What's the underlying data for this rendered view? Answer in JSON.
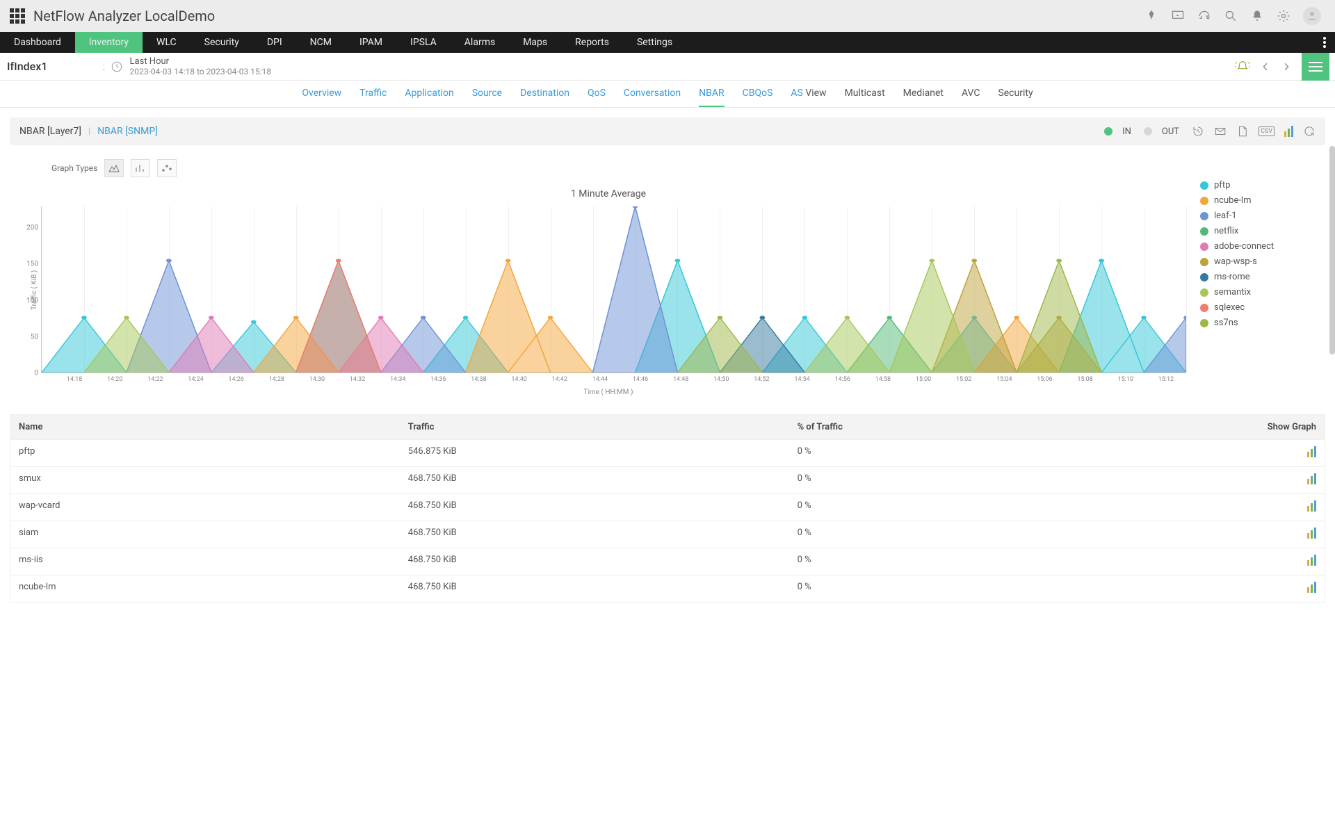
{
  "app_title": "NetFlow Analyzer LocalDemo",
  "nav": [
    "Dashboard",
    "Inventory",
    "WLC",
    "Security",
    "DPI",
    "NCM",
    "IPAM",
    "IPSLA",
    "Alarms",
    "Maps",
    "Reports",
    "Settings"
  ],
  "nav_active": 1,
  "subheader": {
    "interface": "IfIndex1",
    "stray": ";",
    "period_label": "Last Hour",
    "period_range": "2023-04-03 14:18 to 2023-04-03 15:18"
  },
  "tabs": [
    {
      "label": "Overview",
      "plain": false
    },
    {
      "label": "Traffic",
      "plain": false
    },
    {
      "label": "Application",
      "plain": false
    },
    {
      "label": "Source",
      "plain": false
    },
    {
      "label": "Destination",
      "plain": false
    },
    {
      "label": "QoS",
      "plain": false
    },
    {
      "label": "Conversation",
      "plain": false
    },
    {
      "label": "NBAR",
      "plain": false,
      "active": true
    },
    {
      "label": "CBQoS",
      "plain": false
    },
    {
      "label": "AS View",
      "plain": true,
      "as_prefix": "AS "
    },
    {
      "label": "Multicast",
      "plain": true
    },
    {
      "label": "Medianet",
      "plain": true
    },
    {
      "label": "AVC",
      "plain": true
    },
    {
      "label": "Security",
      "plain": true
    }
  ],
  "panel": {
    "sub_tabs": {
      "layer7": "NBAR [Layer7]",
      "snmp": "NBAR [SNMP]"
    },
    "in_label": "IN",
    "out_label": "OUT",
    "csv_label": "CSV"
  },
  "graph_types_label": "Graph Types",
  "chart_data": {
    "type": "area",
    "title": "1 Minute Average",
    "xlabel": "Time ( HH:MM )",
    "ylabel": "Traffic ( KiB )",
    "ylim": [
      0,
      230
    ],
    "y_ticks": [
      0,
      50,
      100,
      150,
      200
    ],
    "categories": [
      "14:18",
      "14:20",
      "14:22",
      "14:24",
      "14:26",
      "14:28",
      "14:30",
      "14:32",
      "14:34",
      "14:36",
      "14:38",
      "14:40",
      "14:42",
      "14:44",
      "14:46",
      "14:48",
      "14:50",
      "14:52",
      "14:54",
      "14:56",
      "14:58",
      "15:00",
      "15:02",
      "15:04",
      "15:06",
      "15:08",
      "15:10",
      "15:12"
    ],
    "series": [
      {
        "name": "pftp",
        "color": "#35c7d8",
        "values": [
          0,
          76,
          0,
          0,
          0,
          70,
          0,
          155,
          0,
          0,
          76,
          0,
          0,
          0,
          0,
          155,
          0,
          0,
          76,
          0,
          0,
          0,
          76,
          0,
          0,
          155,
          76,
          0
        ]
      },
      {
        "name": "ncube-lm",
        "color": "#f4a63b",
        "values": [
          0,
          0,
          0,
          0,
          0,
          0,
          76,
          0,
          0,
          0,
          0,
          155,
          76,
          0,
          0,
          0,
          0,
          0,
          0,
          0,
          0,
          0,
          0,
          76,
          0,
          0,
          0,
          0
        ]
      },
      {
        "name": "leaf-1",
        "color": "#6f93d6",
        "values": [
          0,
          0,
          0,
          155,
          0,
          0,
          0,
          0,
          0,
          76,
          0,
          0,
          0,
          0,
          230,
          0,
          0,
          0,
          0,
          0,
          0,
          0,
          0,
          0,
          0,
          0,
          0,
          76
        ]
      },
      {
        "name": "netflix",
        "color": "#54b978",
        "values": [
          0,
          0,
          0,
          0,
          0,
          0,
          0,
          0,
          0,
          0,
          0,
          0,
          0,
          0,
          0,
          0,
          0,
          0,
          0,
          0,
          76,
          0,
          0,
          0,
          0,
          0,
          0,
          0
        ]
      },
      {
        "name": "adobe-connect",
        "color": "#e07cb5",
        "values": [
          0,
          0,
          0,
          0,
          76,
          0,
          0,
          0,
          76,
          0,
          0,
          0,
          0,
          0,
          0,
          0,
          0,
          0,
          0,
          0,
          0,
          0,
          0,
          0,
          0,
          0,
          0,
          0
        ]
      },
      {
        "name": "wap-wsp-s",
        "color": "#bda33e",
        "values": [
          0,
          0,
          0,
          0,
          0,
          0,
          0,
          0,
          0,
          0,
          0,
          0,
          0,
          0,
          0,
          0,
          0,
          0,
          0,
          0,
          0,
          0,
          155,
          0,
          76,
          0,
          0,
          0
        ]
      },
      {
        "name": "ms-rome",
        "color": "#357a9e",
        "values": [
          0,
          0,
          0,
          0,
          0,
          0,
          0,
          0,
          0,
          0,
          0,
          0,
          0,
          0,
          0,
          0,
          0,
          76,
          0,
          0,
          0,
          0,
          0,
          0,
          0,
          0,
          0,
          0
        ]
      },
      {
        "name": "semantix",
        "color": "#a5c85a",
        "values": [
          0,
          0,
          76,
          0,
          0,
          0,
          0,
          0,
          0,
          0,
          0,
          0,
          0,
          0,
          0,
          0,
          0,
          0,
          0,
          76,
          0,
          155,
          0,
          0,
          0,
          0,
          0,
          0
        ]
      },
      {
        "name": "sqlexec",
        "color": "#f07d6e",
        "values": [
          0,
          0,
          0,
          0,
          0,
          0,
          0,
          155,
          0,
          0,
          0,
          0,
          0,
          0,
          0,
          0,
          0,
          0,
          0,
          0,
          0,
          0,
          0,
          0,
          0,
          0,
          0,
          0
        ]
      },
      {
        "name": "ss7ns",
        "color": "#9db847",
        "values": [
          0,
          0,
          0,
          0,
          0,
          0,
          0,
          0,
          0,
          0,
          0,
          0,
          0,
          0,
          0,
          0,
          76,
          0,
          0,
          0,
          0,
          0,
          0,
          0,
          155,
          0,
          0,
          0
        ]
      }
    ]
  },
  "table": {
    "headers": {
      "name": "Name",
      "traffic": "Traffic",
      "pct": "% of Traffic",
      "graph": "Show Graph"
    },
    "rows": [
      {
        "name": "pftp",
        "traffic": "546.875 KiB",
        "pct": "0 %"
      },
      {
        "name": "smux",
        "traffic": "468.750 KiB",
        "pct": "0 %"
      },
      {
        "name": "wap-vcard",
        "traffic": "468.750 KiB",
        "pct": "0 %"
      },
      {
        "name": "siam",
        "traffic": "468.750 KiB",
        "pct": "0 %"
      },
      {
        "name": "ms-iis",
        "traffic": "468.750 KiB",
        "pct": "0 %"
      },
      {
        "name": "ncube-lm",
        "traffic": "468.750 KiB",
        "pct": "0 %"
      }
    ]
  }
}
